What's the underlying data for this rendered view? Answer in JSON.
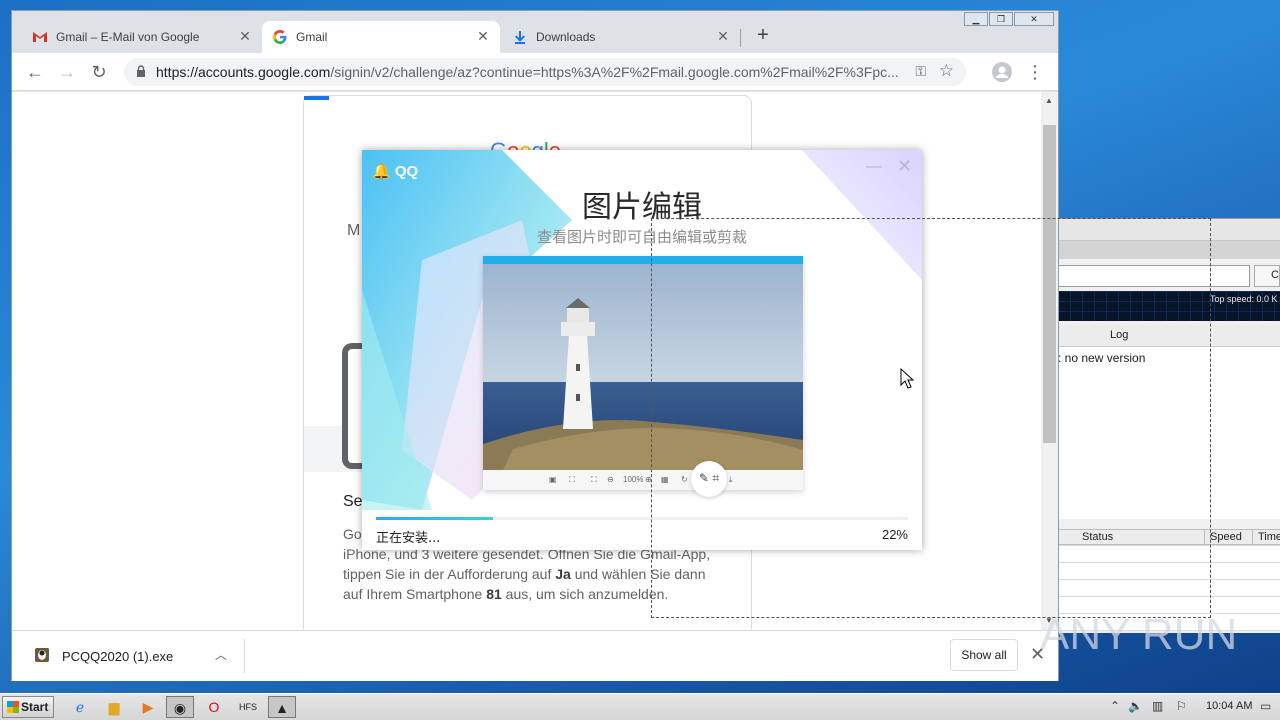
{
  "browser": {
    "tabs": [
      {
        "label": "Gmail – E-Mail von Google",
        "icon": "gmail-icon"
      },
      {
        "label": "Gmail",
        "icon": "google-g-icon"
      },
      {
        "label": "Downloads",
        "icon": "download-icon"
      }
    ],
    "url_host": "https://accounts.google.com",
    "url_path": "/signin/v2/challenge/az?continue=https%3A%2F%2Fmail.google.com%2Fmail%2F%3Fpc...",
    "colors": {
      "accent": "#1a73e8",
      "frame": "#dee1e6"
    }
  },
  "page": {
    "logo_text": "Google",
    "heading_initial": "M",
    "section_title": "Se",
    "paragraph_line1": "Go",
    "paragraph_line2": "iPhone, und 3 weitere gesendet. Öffnen Sie die Gmail-App,",
    "paragraph_line3_a": "tippen Sie in der Aufforderung auf ",
    "paragraph_line3_b": "Ja",
    "paragraph_line3_c": " und wählen Sie dann",
    "paragraph_line4_a": "auf Ihrem Smartphone ",
    "paragraph_line4_b": "81",
    "paragraph_line4_c": " aus, um sich anzumelden."
  },
  "download_bar": {
    "file_name": "PCQQ2020 (1).exe",
    "show_all_label": "Show all"
  },
  "qq_installer": {
    "logo_text": "QQ",
    "title": "图片编辑",
    "subtitle": "查看图片时即可自由编辑或剪裁",
    "status_text": "正在安装...",
    "progress_percent": 22,
    "progress_label": "22%",
    "zoom_label": "100%"
  },
  "background_app": {
    "top_speed": "Top speed: 0.0 K",
    "c_button": "C",
    "log_header": "Log",
    "log_line": ": no new version",
    "columns": [
      "Status",
      "Speed",
      "Time"
    ]
  },
  "taskbar": {
    "start_label": "Start",
    "clock": "10:04 AM"
  },
  "watermark": "ANY RUN"
}
